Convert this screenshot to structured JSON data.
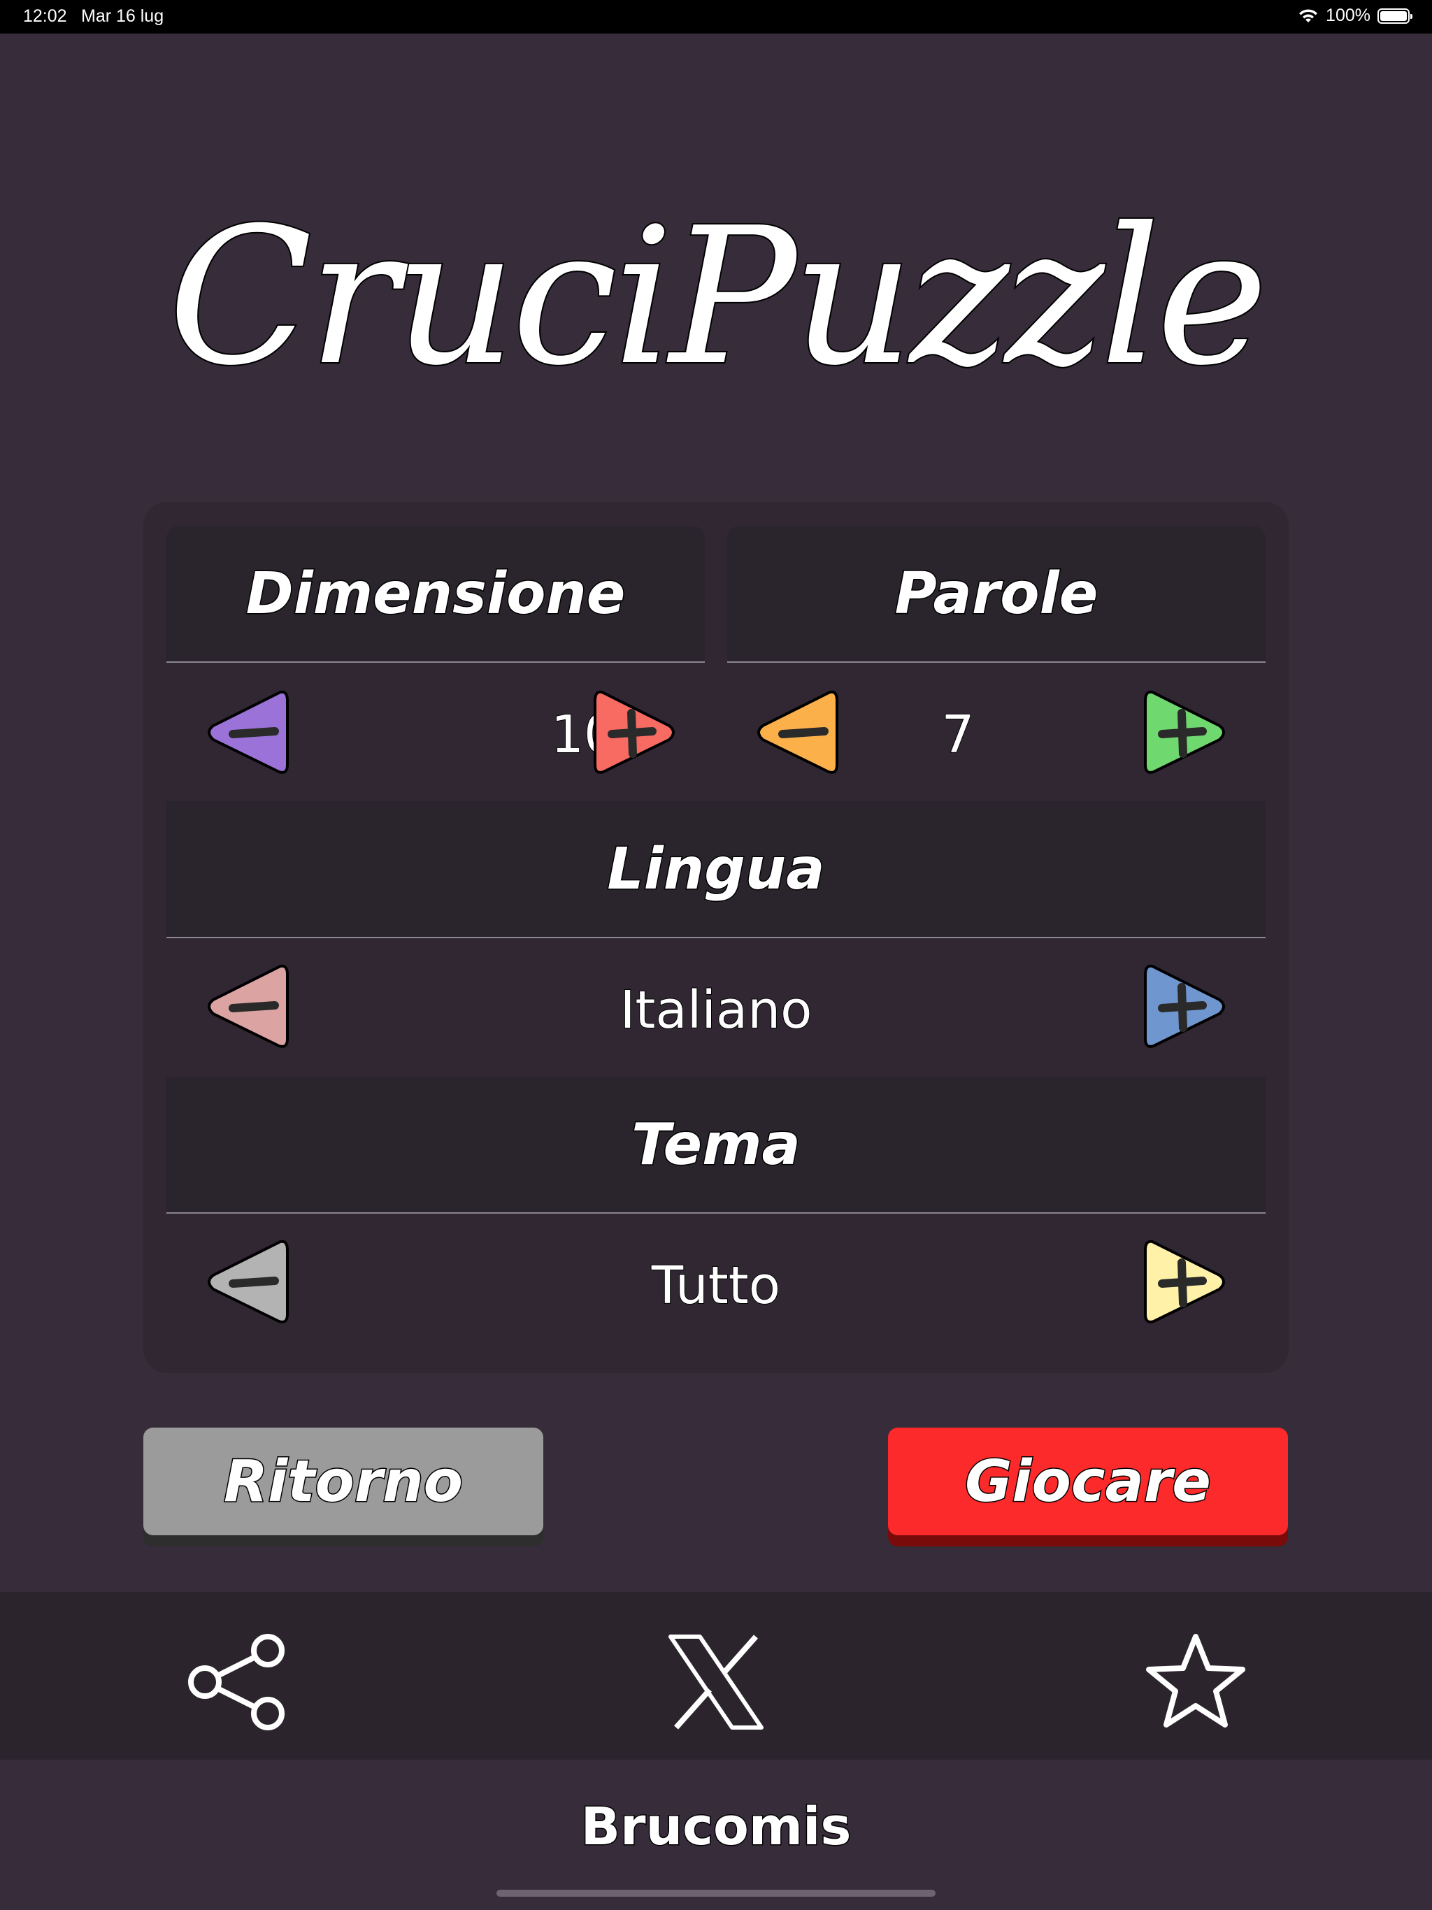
{
  "status": {
    "time": "12:02",
    "date": "Mar 16 lug",
    "battery": "100%"
  },
  "app_title": "CruciPuzzle",
  "settings": {
    "dimensione": {
      "label": "Dimensione",
      "value": "10"
    },
    "parole": {
      "label": "Parole",
      "value": "7"
    },
    "lingua": {
      "label": "Lingua",
      "value": "Italiano"
    },
    "tema": {
      "label": "Tema",
      "value": "Tutto"
    }
  },
  "arrow_colors": {
    "dimensione_minus": "#9a72d8",
    "dimensione_plus": "#f76b63",
    "parole_minus": "#fcb04a",
    "parole_plus": "#6fd86f",
    "lingua_minus": "#dca3a3",
    "lingua_plus": "#6f96ce",
    "tema_minus": "#b3b3b3",
    "tema_plus": "#fff1a8"
  },
  "buttons": {
    "back": "Ritorno",
    "play": "Giocare"
  },
  "footer": {
    "icons": [
      "share-icon",
      "x-logo-icon",
      "star-icon"
    ],
    "brand": "Brucomis"
  }
}
